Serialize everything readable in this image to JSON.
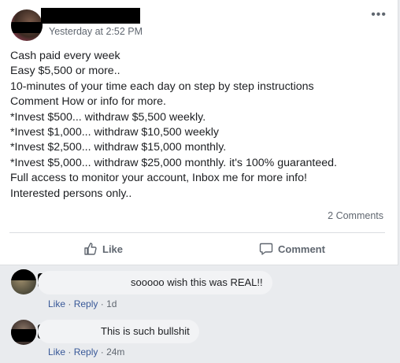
{
  "post": {
    "timestamp": "Yesterday at 2:52 PM",
    "more_label": "•••",
    "lines": [
      "Cash paid every week",
      "Easy $5,500 or more..",
      "10-minutes of your time each day on step by step instructions",
      "Comment How or info for more.",
      "*Invest $500... withdraw $5,500 weekly.",
      "*Invest $1,000... withdraw $10,500 weekly",
      "*Invest $2,500... withdraw $15,000 monthly.",
      "*Invest $5,000... withdraw $25,000 monthly. it's 100% guaranteed.",
      "Full access to monitor your account, Inbox me for more info!",
      "Interested persons only.."
    ],
    "comments_count": "2 Comments",
    "like_label": "Like",
    "comment_label": "Comment"
  },
  "comments": [
    {
      "text": "sooooo wish this was REAL!!",
      "like": "Like",
      "sep": "·",
      "reply": "Reply",
      "sep2": "·",
      "time": "1d"
    },
    {
      "text": "This is such bullshit",
      "like": "Like",
      "sep": "·",
      "reply": "Reply",
      "sep2": "·",
      "time": "24m"
    }
  ]
}
